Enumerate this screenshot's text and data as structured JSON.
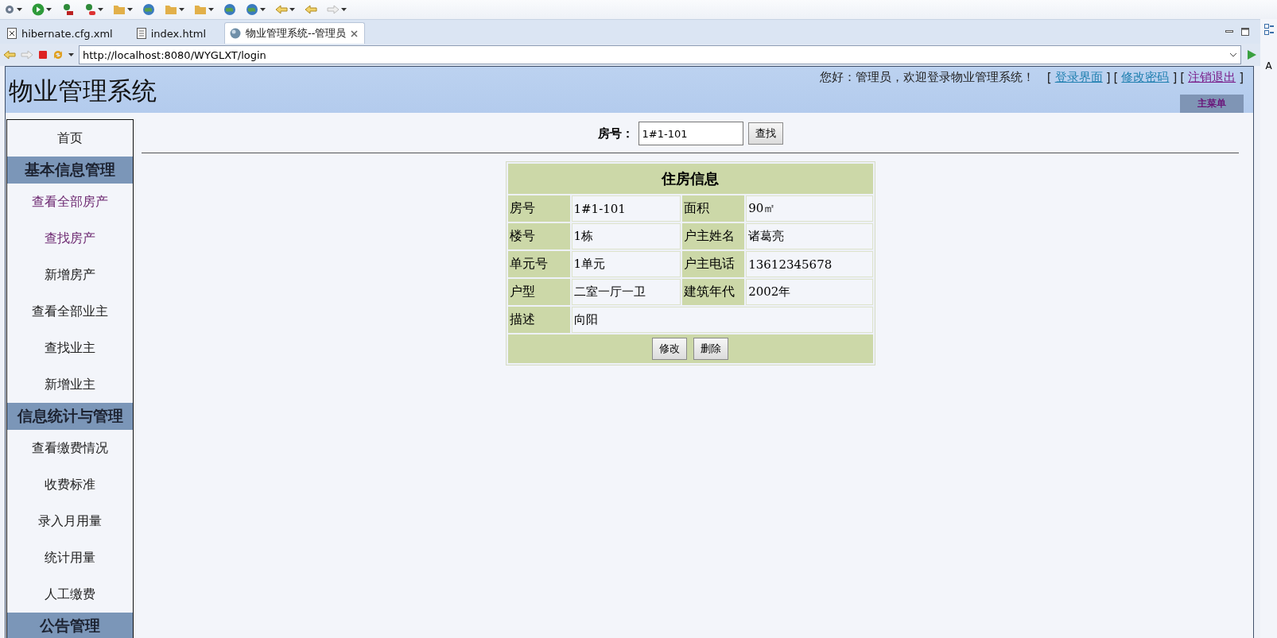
{
  "editor_tabs": [
    {
      "label": "hibernate.cfg.xml",
      "kind": "xml",
      "selected": false
    },
    {
      "label": "index.html",
      "kind": "html",
      "selected": false
    },
    {
      "label": "物业管理系统--管理员",
      "kind": "web",
      "selected": true
    }
  ],
  "address_bar": {
    "url": "http://localhost:8080/WYGLXT/login"
  },
  "header": {
    "title": "物业管理系统",
    "greeting": "您好：管理员，欢迎登录物业管理系统！",
    "links": [
      {
        "before": "[",
        "label": "登录界面",
        "after": "]",
        "visited": false
      },
      {
        "before": "[",
        "label": "修改密码",
        "after": "]",
        "visited": false
      },
      {
        "before": "[",
        "label": "注销退出",
        "after": "]",
        "visited": true
      }
    ],
    "main_menu": "主菜单"
  },
  "sidebar": {
    "items": [
      {
        "kind": "link",
        "label": "首页",
        "visited": false
      },
      {
        "kind": "heading",
        "label": "基本信息管理"
      },
      {
        "kind": "link",
        "label": "查看全部房产",
        "visited": true
      },
      {
        "kind": "link",
        "label": "查找房产",
        "visited": true
      },
      {
        "kind": "link",
        "label": "新增房产",
        "visited": false
      },
      {
        "kind": "link",
        "label": "查看全部业主",
        "visited": false
      },
      {
        "kind": "link",
        "label": "查找业主",
        "visited": false
      },
      {
        "kind": "link",
        "label": "新增业主",
        "visited": false
      },
      {
        "kind": "heading",
        "label": "信息统计与管理"
      },
      {
        "kind": "link",
        "label": "查看缴费情况",
        "visited": false
      },
      {
        "kind": "link",
        "label": "收费标准",
        "visited": false
      },
      {
        "kind": "link",
        "label": "录入月用量",
        "visited": false
      },
      {
        "kind": "link",
        "label": "统计用量",
        "visited": false
      },
      {
        "kind": "link",
        "label": "人工缴费",
        "visited": false
      },
      {
        "kind": "heading",
        "label": "公告管理"
      }
    ]
  },
  "search": {
    "label": "房号：",
    "value": "1#1-101",
    "button": "查找"
  },
  "house_info": {
    "title": "住房信息",
    "rows": [
      [
        {
          "label": "房号",
          "value": "1#1-101"
        },
        {
          "label": "面积",
          "value": "90㎡"
        }
      ],
      [
        {
          "label": "楼号",
          "value": "1栋"
        },
        {
          "label": "户主姓名",
          "value": "诸葛亮"
        }
      ],
      [
        {
          "label": "单元号",
          "value": "1单元"
        },
        {
          "label": "户主电话",
          "value": "13612345678"
        }
      ],
      [
        {
          "label": "户型",
          "value": "二室一厅一卫"
        },
        {
          "label": "建筑年代",
          "value": "2002年"
        }
      ],
      [
        {
          "label": "描述",
          "value": "向阳"
        }
      ]
    ],
    "buttons": [
      "修改",
      "删除"
    ]
  },
  "side_strip": {
    "label": "A"
  }
}
